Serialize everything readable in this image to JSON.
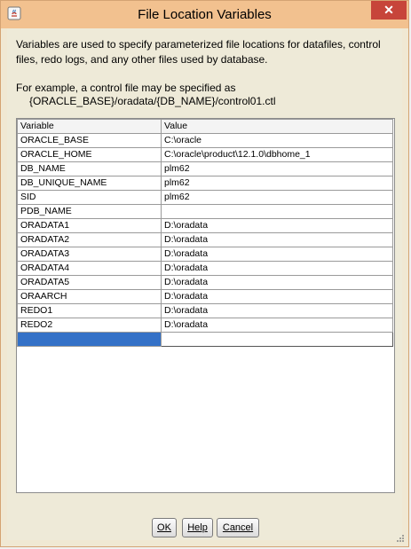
{
  "window": {
    "title": "File Location Variables",
    "close_label": "✕"
  },
  "description": "Variables are used to specify parameterized file locations for datafiles, control files, redo logs, and any other files used by database.",
  "example": {
    "line1": "For example, a control file may be specified as",
    "line2": "{ORACLE_BASE}/oradata/{DB_NAME}/control01.ctl"
  },
  "table": {
    "headers": [
      "Variable",
      "Value"
    ],
    "rows": [
      [
        "ORACLE_BASE",
        "C:\\oracle"
      ],
      [
        "ORACLE_HOME",
        "C:\\oracle\\product\\12.1.0\\dbhome_1"
      ],
      [
        "DB_NAME",
        "plm62"
      ],
      [
        "DB_UNIQUE_NAME",
        "plm62"
      ],
      [
        "SID",
        "plm62"
      ],
      [
        "PDB_NAME",
        ""
      ],
      [
        "ORADATA1",
        "D:\\oradata"
      ],
      [
        "ORADATA2",
        "D:\\oradata"
      ],
      [
        "ORADATA3",
        "D:\\oradata"
      ],
      [
        "ORADATA4",
        "D:\\oradata"
      ],
      [
        "ORADATA5",
        "D:\\oradata"
      ],
      [
        "ORAARCH",
        "D:\\oradata"
      ],
      [
        "REDO1",
        "D:\\oradata"
      ],
      [
        "REDO2",
        "D:\\oradata"
      ],
      [
        "",
        ""
      ]
    ]
  },
  "buttons": {
    "ok": "OK",
    "help": "Help",
    "cancel": "Cancel"
  },
  "colors": {
    "titlebar": "#f2c18f",
    "close": "#c7453a",
    "selection": "#3471c7"
  }
}
